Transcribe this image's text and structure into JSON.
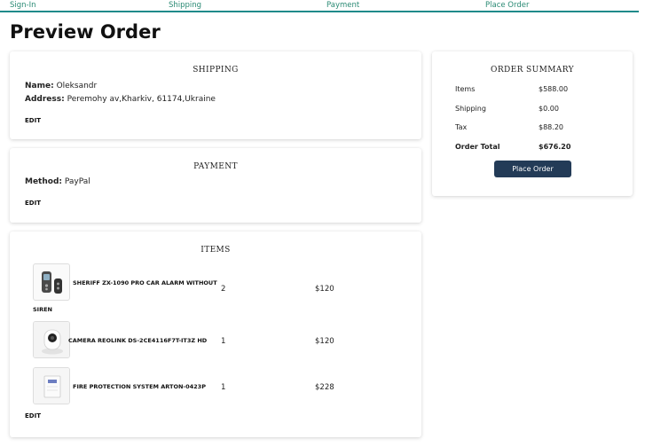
{
  "steps": [
    "Sign-In",
    "Shipping",
    "Payment",
    "Place Order"
  ],
  "page_title": "Preview Order",
  "shipping": {
    "title": "SHIPPING",
    "name_label": "Name:",
    "name_value": "Oleksandr",
    "address_label": "Address:",
    "address_value": "Peremohy av,Kharkiv, 61174,Ukraine",
    "edit": "EDIT"
  },
  "payment": {
    "title": "PAYMENT",
    "method_label": "Method:",
    "method_value": "PayPal",
    "edit": "EDIT"
  },
  "items": {
    "title": "ITEMS",
    "list": [
      {
        "name_line1": "SHERIFF ZX-1090 PRO CAR ALARM WITHOUT",
        "name_line2": "SIREN",
        "qty": "2",
        "price": "$120",
        "icon": "car-alarm-remote-icon"
      },
      {
        "name_line1": "CAMERA REOLINK DS-2CE4116F7T-IT3Z HD",
        "name_line2": "",
        "qty": "1",
        "price": "$120",
        "icon": "security-camera-icon"
      },
      {
        "name_line1": "FIRE PROTECTION SYSTEM ARTON-0423P",
        "name_line2": "",
        "qty": "1",
        "price": "$228",
        "icon": "fire-panel-icon"
      }
    ],
    "edit": "EDIT"
  },
  "summary": {
    "title": "ORDER SUMMARY",
    "rows": [
      {
        "label": "Items",
        "value": "$588.00"
      },
      {
        "label": "Shipping",
        "value": "$0.00"
      },
      {
        "label": "Tax",
        "value": "$88.20"
      },
      {
        "label": "Order Total",
        "value": "$676.20"
      }
    ],
    "button": "Place Order"
  },
  "colors": {
    "step_text": "#2a8a74",
    "step_line": "#1f8a8a",
    "button_bg": "#233b57"
  }
}
